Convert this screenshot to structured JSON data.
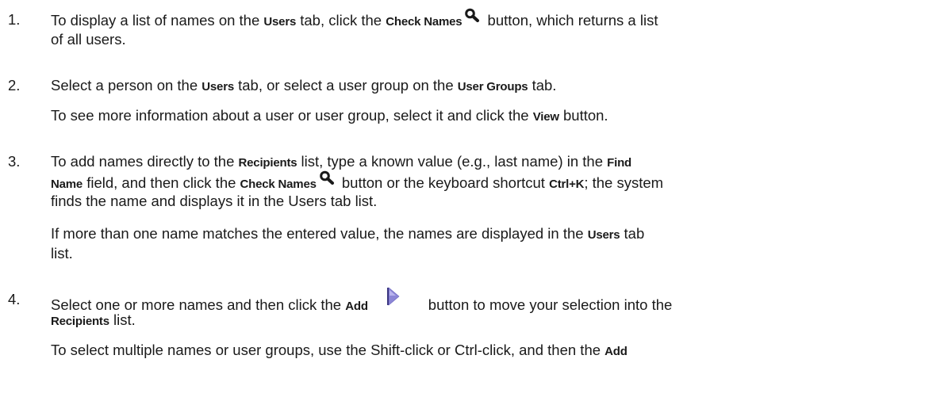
{
  "steps": [
    {
      "number": "1.",
      "lines": [
        [
          {
            "t": "text",
            "v": "To display a list of names on the "
          },
          {
            "t": "bold",
            "v": "Users"
          },
          {
            "t": "text",
            "v": " tab, click the "
          },
          {
            "t": "bold",
            "v": "Check Names"
          },
          {
            "t": "icon",
            "v": "magnifier-icon"
          },
          {
            "t": "text",
            "v": " button, which returns a list"
          }
        ],
        [
          {
            "t": "text",
            "v": "of all users."
          }
        ]
      ]
    },
    {
      "number": "2.",
      "lines": [
        [
          {
            "t": "text",
            "v": "Select a person on the "
          },
          {
            "t": "bold",
            "v": "Users"
          },
          {
            "t": "text",
            "v": " tab, or select a user group on the "
          },
          {
            "t": "bold",
            "v": "User Groups"
          },
          {
            "t": "text",
            "v": " tab."
          }
        ],
        [
          {
            "t": "text",
            "v": "To see more information about a user or user group, select it and click the "
          },
          {
            "t": "bold",
            "v": "View"
          },
          {
            "t": "text",
            "v": " button."
          }
        ]
      ]
    },
    {
      "number": "3.",
      "lines": [
        [
          {
            "t": "text",
            "v": "To add names directly to the "
          },
          {
            "t": "bold",
            "v": "Recipients"
          },
          {
            "t": "text",
            "v": " list, type a known value (e.g., last name) in the "
          },
          {
            "t": "bold",
            "v": "Find"
          }
        ],
        [
          {
            "t": "bold",
            "v": "Name"
          },
          {
            "t": "text",
            "v": " field, and then click the "
          },
          {
            "t": "bold",
            "v": "Check Names"
          },
          {
            "t": "icon",
            "v": "magnifier-icon"
          },
          {
            "t": "text",
            "v": " button or the keyboard shortcut "
          },
          {
            "t": "bold",
            "v": "Ctrl+K"
          },
          {
            "t": "text",
            "v": "; the system"
          }
        ],
        [
          {
            "t": "text",
            "v": "finds the name and displays it in the Users tab list."
          }
        ],
        [
          {
            "t": "text",
            "v": "If more than one name matches the entered value, the names are displayed in the "
          },
          {
            "t": "bold",
            "v": "Users"
          },
          {
            "t": "text",
            "v": " tab"
          }
        ],
        [
          {
            "t": "text",
            "v": "list."
          }
        ]
      ]
    },
    {
      "number": "4.",
      "lines": [
        [
          {
            "t": "text",
            "v": "Select one or more names and then click the "
          },
          {
            "t": "bold",
            "v": "Add"
          },
          {
            "t": "icon",
            "v": "add-arrow-icon"
          },
          {
            "t": "text",
            "v": "button to move your selection into the"
          }
        ],
        [
          {
            "t": "bold",
            "v": "Recipients"
          },
          {
            "t": "text",
            "v": " list."
          }
        ],
        [
          {
            "t": "text",
            "v": "To select multiple names or user groups, use the Shift-click or Ctrl-click, and then the "
          },
          {
            "t": "bold",
            "v": "Add"
          }
        ]
      ]
    }
  ],
  "colors": {
    "text": "#1a1a1a",
    "add_icon_fill": "#8c86d6",
    "add_icon_edge": "#3b3680"
  }
}
